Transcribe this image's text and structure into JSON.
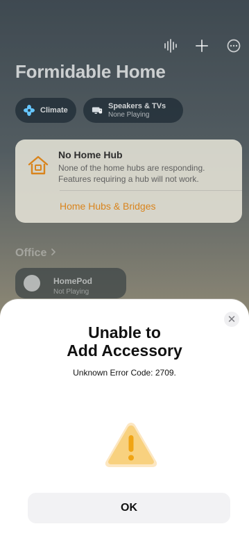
{
  "top_icons": [
    {
      "name": "waveform-icon"
    },
    {
      "name": "plus-icon"
    },
    {
      "name": "more-icon"
    }
  ],
  "home": {
    "title": "Formidable Home",
    "chips": [
      {
        "label": "Climate",
        "subtitle": "",
        "icon": "fan-icon"
      },
      {
        "label": "Speakers & TVs",
        "subtitle": "None Playing",
        "icon": "speaker-tv-icon"
      }
    ],
    "hub_card": {
      "title": "No Home Hub",
      "message": "None of the home hubs are responding. Features requiring a hub will not work.",
      "link": "Home Hubs & Bridges"
    },
    "room": {
      "name": "Office"
    },
    "accessory": {
      "name": "HomePod",
      "status": "Not Playing"
    }
  },
  "sheet": {
    "title_line1": "Unable to",
    "title_line2": "Add Accessory",
    "subtitle": "Unknown Error Code: 2709.",
    "button": "OK"
  },
  "colors": {
    "accent": "#d9841d",
    "warning": "#f4a826",
    "sheet_bg": "#ffffff",
    "button_bg": "#f2f2f4"
  }
}
